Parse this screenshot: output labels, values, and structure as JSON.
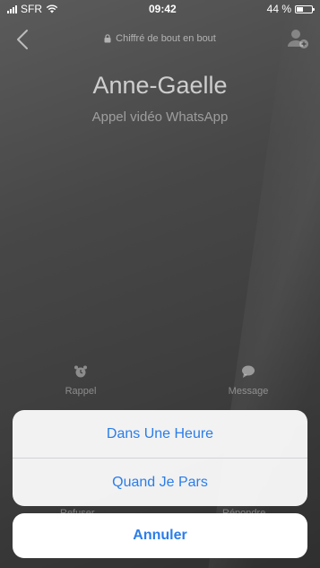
{
  "status_bar": {
    "carrier": "SFR",
    "time": "09:42",
    "battery_text": "44 %",
    "battery_level": 0.44
  },
  "header": {
    "encryption_text": "Chiffré de bout en bout",
    "back_icon": "chevron-left-icon",
    "add_icon": "add-participant-icon"
  },
  "call": {
    "caller_name": "Anne-Gaelle",
    "call_type": "Appel vidéo WhatsApp"
  },
  "quick_actions": {
    "reminder_label": "Rappel",
    "message_label": "Message"
  },
  "call_buttons": {
    "decline_label": "Refuser",
    "accept_label": "Répondre"
  },
  "action_sheet": {
    "options": [
      "Dans Une Heure",
      "Quand Je Pars"
    ],
    "cancel_label": "Annuler"
  },
  "colors": {
    "accent": "#2b7de9",
    "sheet_background": "#f8f8f8"
  }
}
